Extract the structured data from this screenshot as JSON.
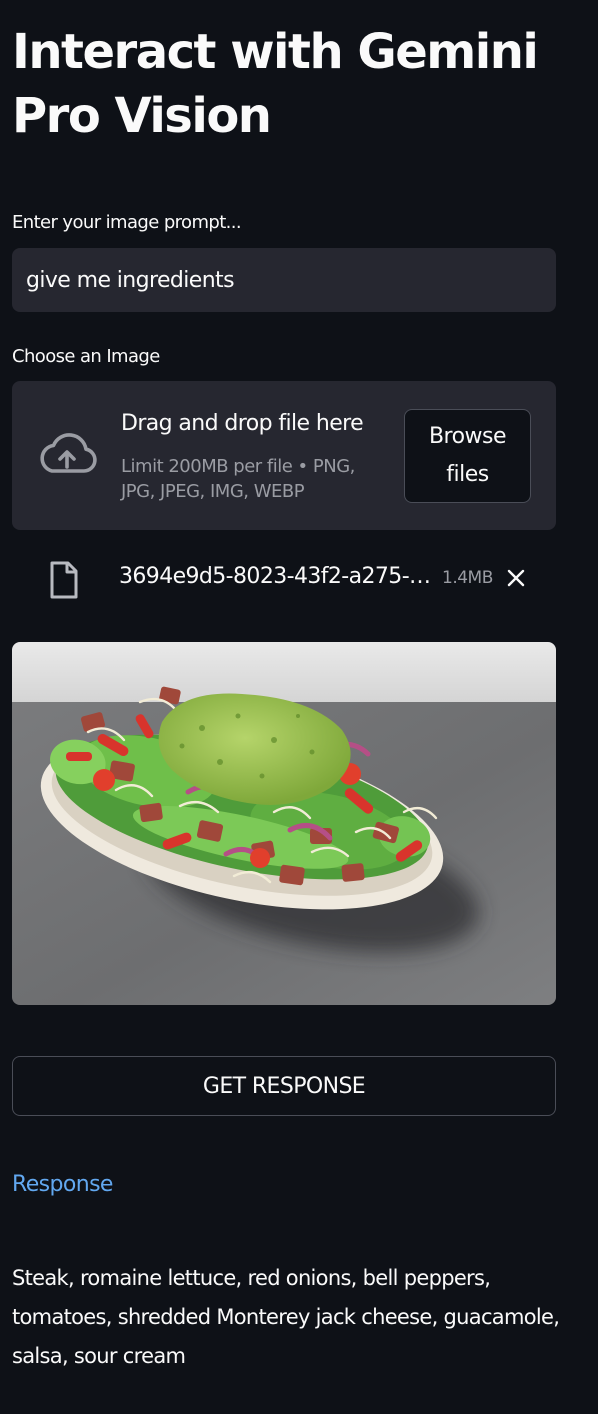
{
  "page": {
    "title": "Interact with Gemini Pro Vision"
  },
  "prompt": {
    "label": "Enter your image prompt...",
    "value": "give me ingredients"
  },
  "uploader": {
    "label": "Choose an Image",
    "dropzone_title": "Drag and drop file here",
    "limit_text": "Limit 200MB per file • PNG, JPG, JPEG, IMG, WEBP",
    "browse_label": "Browse files",
    "icon": "cloud-upload-icon"
  },
  "uploaded_file": {
    "name": "3694e9d5-8023-43f2-a275-…",
    "size": "1.4MB",
    "icon": "file-icon",
    "remove_icon": "close-icon"
  },
  "submit": {
    "label": "GET RESPONSE"
  },
  "response": {
    "heading": "Response",
    "text": "Steak, romaine lettuce, red onions, bell peppers, tomatoes, shredded Monterey jack cheese, guacamole, salsa, sour cream"
  },
  "colors": {
    "background": "#0e1117",
    "surface": "#262730",
    "text": "#fafafa",
    "muted": "#9a9ca3",
    "accent_link": "#62a8f0",
    "border": "#4a4d57"
  }
}
